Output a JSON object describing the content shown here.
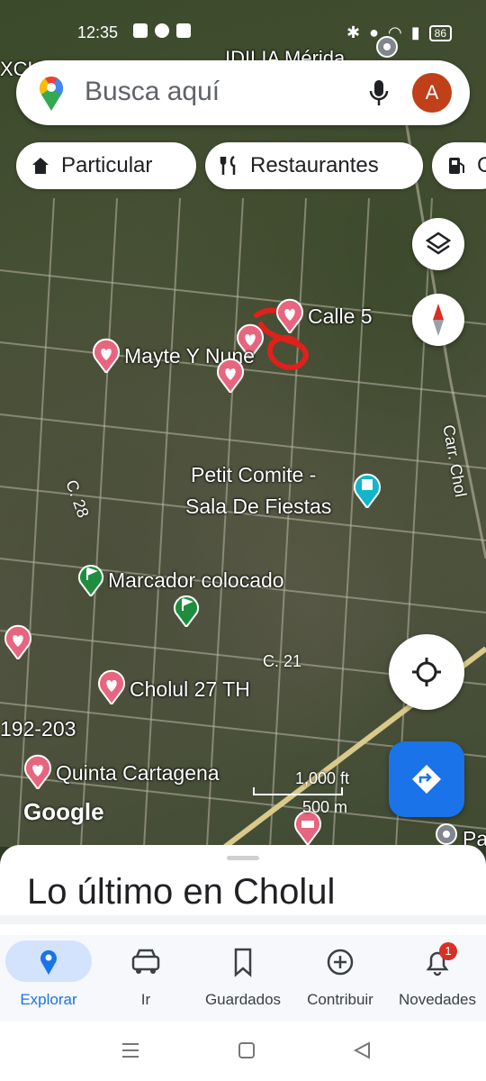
{
  "status_bar": {
    "time": "12:35",
    "battery": "86"
  },
  "search": {
    "placeholder": "Busca aquí",
    "avatar_letter": "A"
  },
  "chips": [
    {
      "label": "Particular",
      "icon": "home-icon"
    },
    {
      "label": "Restaurantes",
      "icon": "restaurant-icon"
    },
    {
      "label": "G",
      "icon": "gas-station-icon"
    }
  ],
  "map_labels": {
    "top_partial": "IDILIA Mérida",
    "top_left_partial": "XCH",
    "calle5": "Calle 5",
    "mayte": "Mayte Y Nune",
    "petit_line1": "Petit Comite -",
    "petit_line2": "Sala De Fiestas",
    "marcador": "Marcador colocado",
    "cholul27": "Cholul 27 TH",
    "quinta": "Quinta Cartagena",
    "street_c28": "C. 28",
    "street_c21": "C. 21",
    "street_carr": "Carr. Chol",
    "num_range": "192-203",
    "bottom_right_partial": "Pa"
  },
  "scale": {
    "imperial": "1,000 ft",
    "metric": "500 m"
  },
  "attribution": "Google",
  "sheet": {
    "title": "Lo último en Cholul"
  },
  "nav": [
    {
      "label": "Explorar",
      "icon": "explore-pin-icon",
      "active": true
    },
    {
      "label": "Ir",
      "icon": "car-icon"
    },
    {
      "label": "Guardados",
      "icon": "bookmark-icon"
    },
    {
      "label": "Contribuir",
      "icon": "add-circle-icon"
    },
    {
      "label": "Novedades",
      "icon": "bell-icon",
      "badge": "1"
    }
  ],
  "colors": {
    "accent": "#1a73e8",
    "heart_pin": "#e8657f",
    "avatar": "#c0401a",
    "annotation": "#e0201c"
  }
}
